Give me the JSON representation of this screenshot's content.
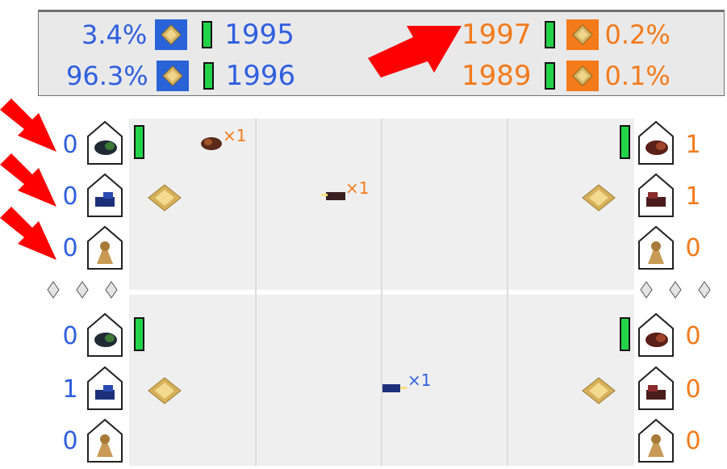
{
  "header": {
    "left": [
      {
        "pct": "3.4%",
        "year": "1995"
      },
      {
        "pct": "96.3%",
        "year": "1996"
      }
    ],
    "right": [
      {
        "pct": "0.2%",
        "year": "1997"
      },
      {
        "pct": "0.1%",
        "year": "1989"
      }
    ]
  },
  "top": {
    "left_counts": [
      "0",
      "0",
      "0"
    ],
    "right_counts": [
      "1",
      "1",
      "0"
    ],
    "unit1_count": "×1",
    "unit2_count": "×1"
  },
  "bottom": {
    "left_counts": [
      "0",
      "1",
      "0"
    ],
    "right_counts": [
      "0",
      "0",
      "0"
    ],
    "unit_count": "×1"
  },
  "colors": {
    "player_blue": "#2f5fe0",
    "player_orange": "#f47a1a",
    "health_green": "#22d34a",
    "arrow_red": "#ff0000"
  }
}
